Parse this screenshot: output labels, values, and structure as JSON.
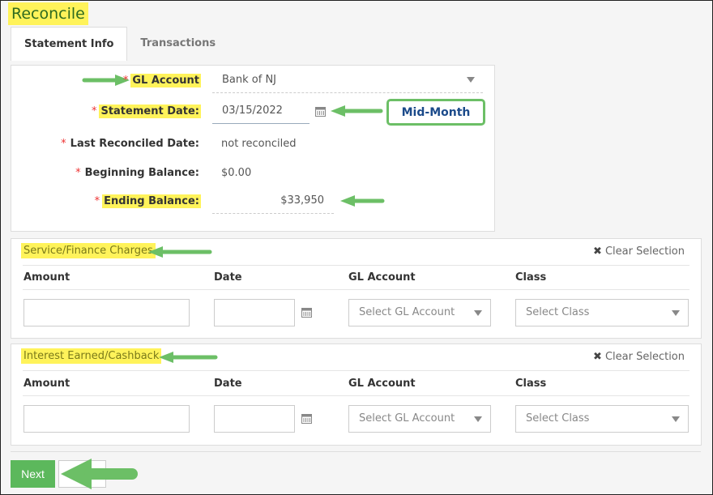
{
  "page": {
    "title": "Reconcile"
  },
  "tabs": [
    {
      "label": "Statement Info",
      "active": true
    },
    {
      "label": "Transactions",
      "active": false
    }
  ],
  "statement": {
    "gl_account": {
      "label": "GL Account",
      "value": "Bank of NJ"
    },
    "statement_date": {
      "label": "Statement Date:",
      "value": "03/15/2022"
    },
    "last_reconciled": {
      "label": "Last Reconciled Date:",
      "value": "not reconciled"
    },
    "beginning_balance": {
      "label": "Beginning Balance:",
      "value": "$0.00"
    },
    "ending_balance": {
      "label": "Ending Balance:",
      "value": "$33,950"
    },
    "required_marker": "*",
    "annotation_badge": "Mid-Month"
  },
  "service_charges": {
    "title": "Service/Finance Charges",
    "clear_label": "Clear Selection",
    "columns": [
      "Amount",
      "Date",
      "GL Account",
      "Class"
    ],
    "amount_value": "",
    "date_value": "",
    "gl_placeholder": "Select GL Account",
    "class_placeholder": "Select Class"
  },
  "interest_earned": {
    "title": "Interest Earned/Cashback",
    "clear_label": "Clear Selection",
    "columns": [
      "Amount",
      "Date",
      "GL Account",
      "Class"
    ],
    "amount_value": "",
    "date_value": "",
    "gl_placeholder": "Select GL Account",
    "class_placeholder": "Select Class"
  },
  "footer": {
    "next_label": "Next"
  },
  "colors": {
    "highlight": "#fff35a",
    "arrow": "#6cbf66",
    "next_button": "#5cb85c",
    "badge_text": "#1b4a8a"
  }
}
